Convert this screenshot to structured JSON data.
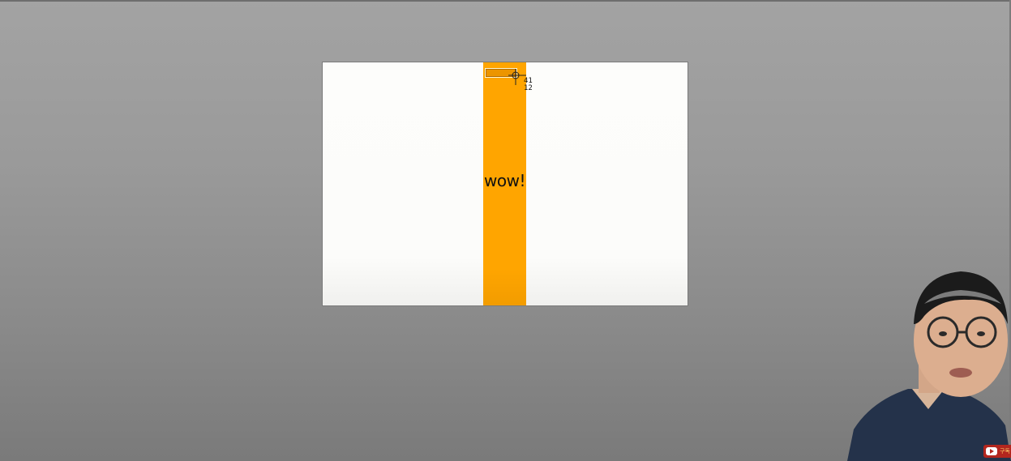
{
  "canvas": {
    "column_text": "wow!",
    "column_color": "#ffa500",
    "cursor_icon": "crosshair-icon",
    "coordinate_readout": {
      "x": "41",
      "y": "12"
    }
  },
  "overlay": {
    "presenter_icon": "presenter-webcam",
    "badge_icon": "youtube-play-icon",
    "badge_text": "구독"
  },
  "colors": {
    "background": "#9a9a9a",
    "canvas_bg": "#fdfdfb",
    "accent": "#ffa500"
  }
}
